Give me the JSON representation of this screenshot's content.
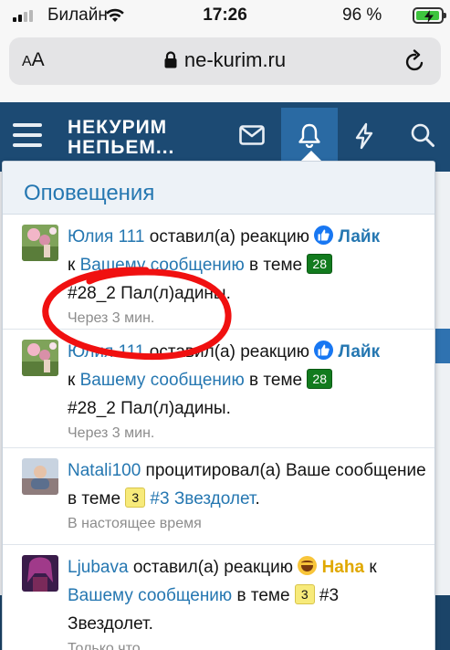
{
  "status_bar": {
    "carrier": "Билайн",
    "time": "17:26",
    "battery_percent": "96 %",
    "battery_level": 0.96
  },
  "browser": {
    "text_size_label_small": "A",
    "text_size_label_large": "A",
    "url": "ne-kurim.ru"
  },
  "site_header": {
    "logo_line1": "НЕКУРИМ",
    "logo_line2": "НЕПЬЕМ..."
  },
  "alerts_popup": {
    "title": "Оповещения",
    "alerts": [
      {
        "user": "Юлия 111",
        "action": " оставил(а) реакцию ",
        "reaction": "Лайк",
        "to": "к ",
        "link": "Вашему сообщению",
        "in_thread": " в теме ",
        "badge": "28",
        "thread": "#28_2 Пал(л)адины.",
        "time": "Через 3 мин."
      },
      {
        "user": "Юлия 111",
        "action": " оставил(а) реакцию ",
        "reaction": "Лайк",
        "to": "к ",
        "link": "Вашему сообщению",
        "in_thread": " в теме ",
        "badge": "28",
        "thread": "#28_2 Пал(л)адины.",
        "time": "Через 3 мин."
      },
      {
        "user": "Natali100",
        "action": " процитировал(а) Ваше сообщение в теме ",
        "badge": "3",
        "thread_link": "#3 Звездолет",
        "thread_end": ".",
        "time": "В настоящее время"
      },
      {
        "user": "Ljubava",
        "action": " оставил(а) реакцию ",
        "reaction": "Haha",
        "to": " к",
        "link": "Вашему сообщению",
        "in_thread": " в теме ",
        "badge": "3",
        "thread": " #3 Звездолет.",
        "time": "Только что"
      }
    ]
  },
  "colors": {
    "header_bg": "#1c4a73",
    "active_tab": "#2a6aa3",
    "link": "#2577b1",
    "badge_green": "#127b1e",
    "badge_yellow": "#f7ea7a",
    "scribble": "#f01010"
  },
  "icons": {
    "menu": "hamburger-icon",
    "inbox": "envelope-icon",
    "alerts": "bell-icon",
    "whats_new": "bolt-icon",
    "search": "search-icon",
    "lock": "lock-icon",
    "reload": "reload-icon"
  }
}
